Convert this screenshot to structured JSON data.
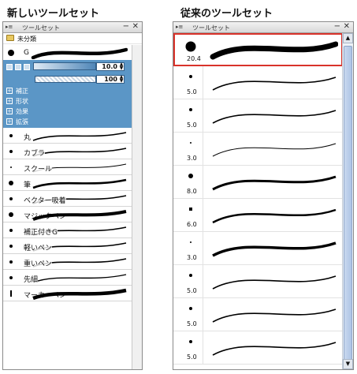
{
  "headings": {
    "new": "新しいツールセット",
    "old": "従来のツールセット"
  },
  "left": {
    "title": "ツールセット",
    "min": "−",
    "close": "✕",
    "group": "未分類",
    "selected_tool": "G",
    "brush_size": "10.0",
    "opacity": "100",
    "categories": [
      "補正",
      "形状",
      "効果",
      "拡張"
    ],
    "tools": [
      {
        "name": "丸"
      },
      {
        "name": "カブラ"
      },
      {
        "name": "スクール"
      },
      {
        "name": "筆"
      },
      {
        "name": "ベクター吸着"
      },
      {
        "name": "マジックペン"
      },
      {
        "name": "補正付きG"
      },
      {
        "name": "軽いペン"
      },
      {
        "name": "重いペン"
      },
      {
        "name": "先細"
      },
      {
        "name": "マーカーペン"
      }
    ]
  },
  "right": {
    "title": "ツールセット",
    "min": "−",
    "close": "✕",
    "sizes": [
      "20.4",
      "5.0",
      "5.0",
      "3.0",
      "8.0",
      "6.0",
      "3.0",
      "5.0",
      "5.0",
      "5.0"
    ]
  }
}
